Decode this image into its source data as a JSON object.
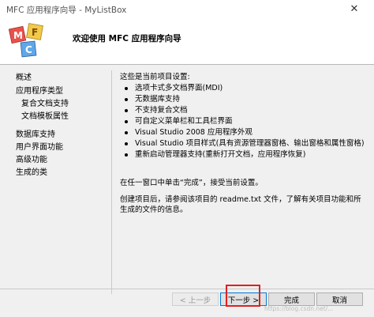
{
  "window": {
    "title": "MFC 应用程序向导 - MyListBox",
    "close_glyph": "✕"
  },
  "header": {
    "title": "欢迎使用 MFC 应用程序向导",
    "logo_letters": [
      "M",
      "F",
      "C"
    ]
  },
  "sidebar": {
    "items": [
      {
        "label": "概述",
        "level": 0
      },
      {
        "label": "应用程序类型",
        "level": 0
      },
      {
        "label": "复合文档支持",
        "level": 1
      },
      {
        "label": "文档模板属性",
        "level": 1
      },
      {
        "label": "数据库支持",
        "level": 0
      },
      {
        "label": "用户界面功能",
        "level": 0
      },
      {
        "label": "高级功能",
        "level": 0
      },
      {
        "label": "生成的类",
        "level": 0
      }
    ]
  },
  "content": {
    "intro": "这些是当前项目设置:",
    "bullets": [
      "选项卡式多文档界面(MDI)",
      "无数据库支持",
      "不支持复合文档",
      "可自定义菜单栏和工具栏界面",
      "Visual Studio 2008 应用程序外观",
      "Visual Studio 项目样式(具有资源管理器窗格、输出窗格和属性窗格)",
      "重新启动管理器支持(重新打开文档，应用程序恢复)"
    ],
    "note": "在任一窗口中单击“完成”，接受当前设置。",
    "note2": "创建项目后，请参阅该项目的 readme.txt 文件，了解有关项目功能和所生成的文件的信息。"
  },
  "buttons": {
    "prev": "< 上一步",
    "next": "下一步 >",
    "finish": "完成",
    "cancel": "取消"
  },
  "watermark": "https://blog.csdn.net/..."
}
